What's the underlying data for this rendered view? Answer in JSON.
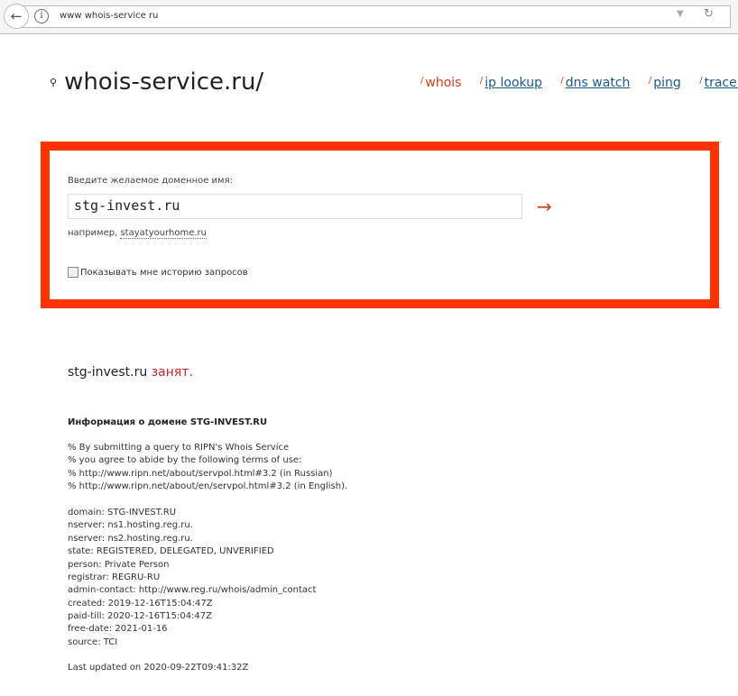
{
  "browser": {
    "url": "www whois-service ru"
  },
  "header": {
    "logo": "whois-service.ru/",
    "nav": [
      {
        "label": "whois",
        "active": true
      },
      {
        "label": "ip lookup"
      },
      {
        "label": "dns watch"
      },
      {
        "label": "ping"
      },
      {
        "label": "trace rou"
      }
    ]
  },
  "form": {
    "label": "Введите желаемое доменное имя:",
    "value": "stg-invest.ru",
    "go": "→",
    "example_prefix": "например,",
    "example_link": "stayatyourhome.ru",
    "history_label": "Показывать мне историю запросов"
  },
  "result": {
    "domain": "stg-invest.ru",
    "status": "занят.",
    "info_heading": "Информация о домене STG-INVEST.RU",
    "lines": [
      "% By submitting a query to RIPN's Whois Service",
      "% you agree to abide by the following terms of use:",
      "% http://www.ripn.net/about/servpol.html#3.2 (in Russian)",
      "% http://www.ripn.net/about/en/servpol.html#3.2 (in English).",
      "",
      "domain: STG-INVEST.RU",
      "nserver: ns1.hosting.reg.ru.",
      "nserver: ns2.hosting.reg.ru.",
      "state: REGISTERED, DELEGATED, UNVERIFIED",
      "person: Private Person",
      "registrar: REGRU-RU",
      "admin-contact: http://www.reg.ru/whois/admin_contact",
      "created: 2019-12-16T15:04:47Z",
      "paid-till: 2020-12-16T15:04:47Z",
      "free-date: 2021-01-16",
      "source: TCI"
    ],
    "updated": "Last updated on 2020-09-22T09:41:32Z"
  },
  "colors": {
    "accent": "#ff3300",
    "busy": "#c0282a",
    "link": "#1a5a8a"
  }
}
